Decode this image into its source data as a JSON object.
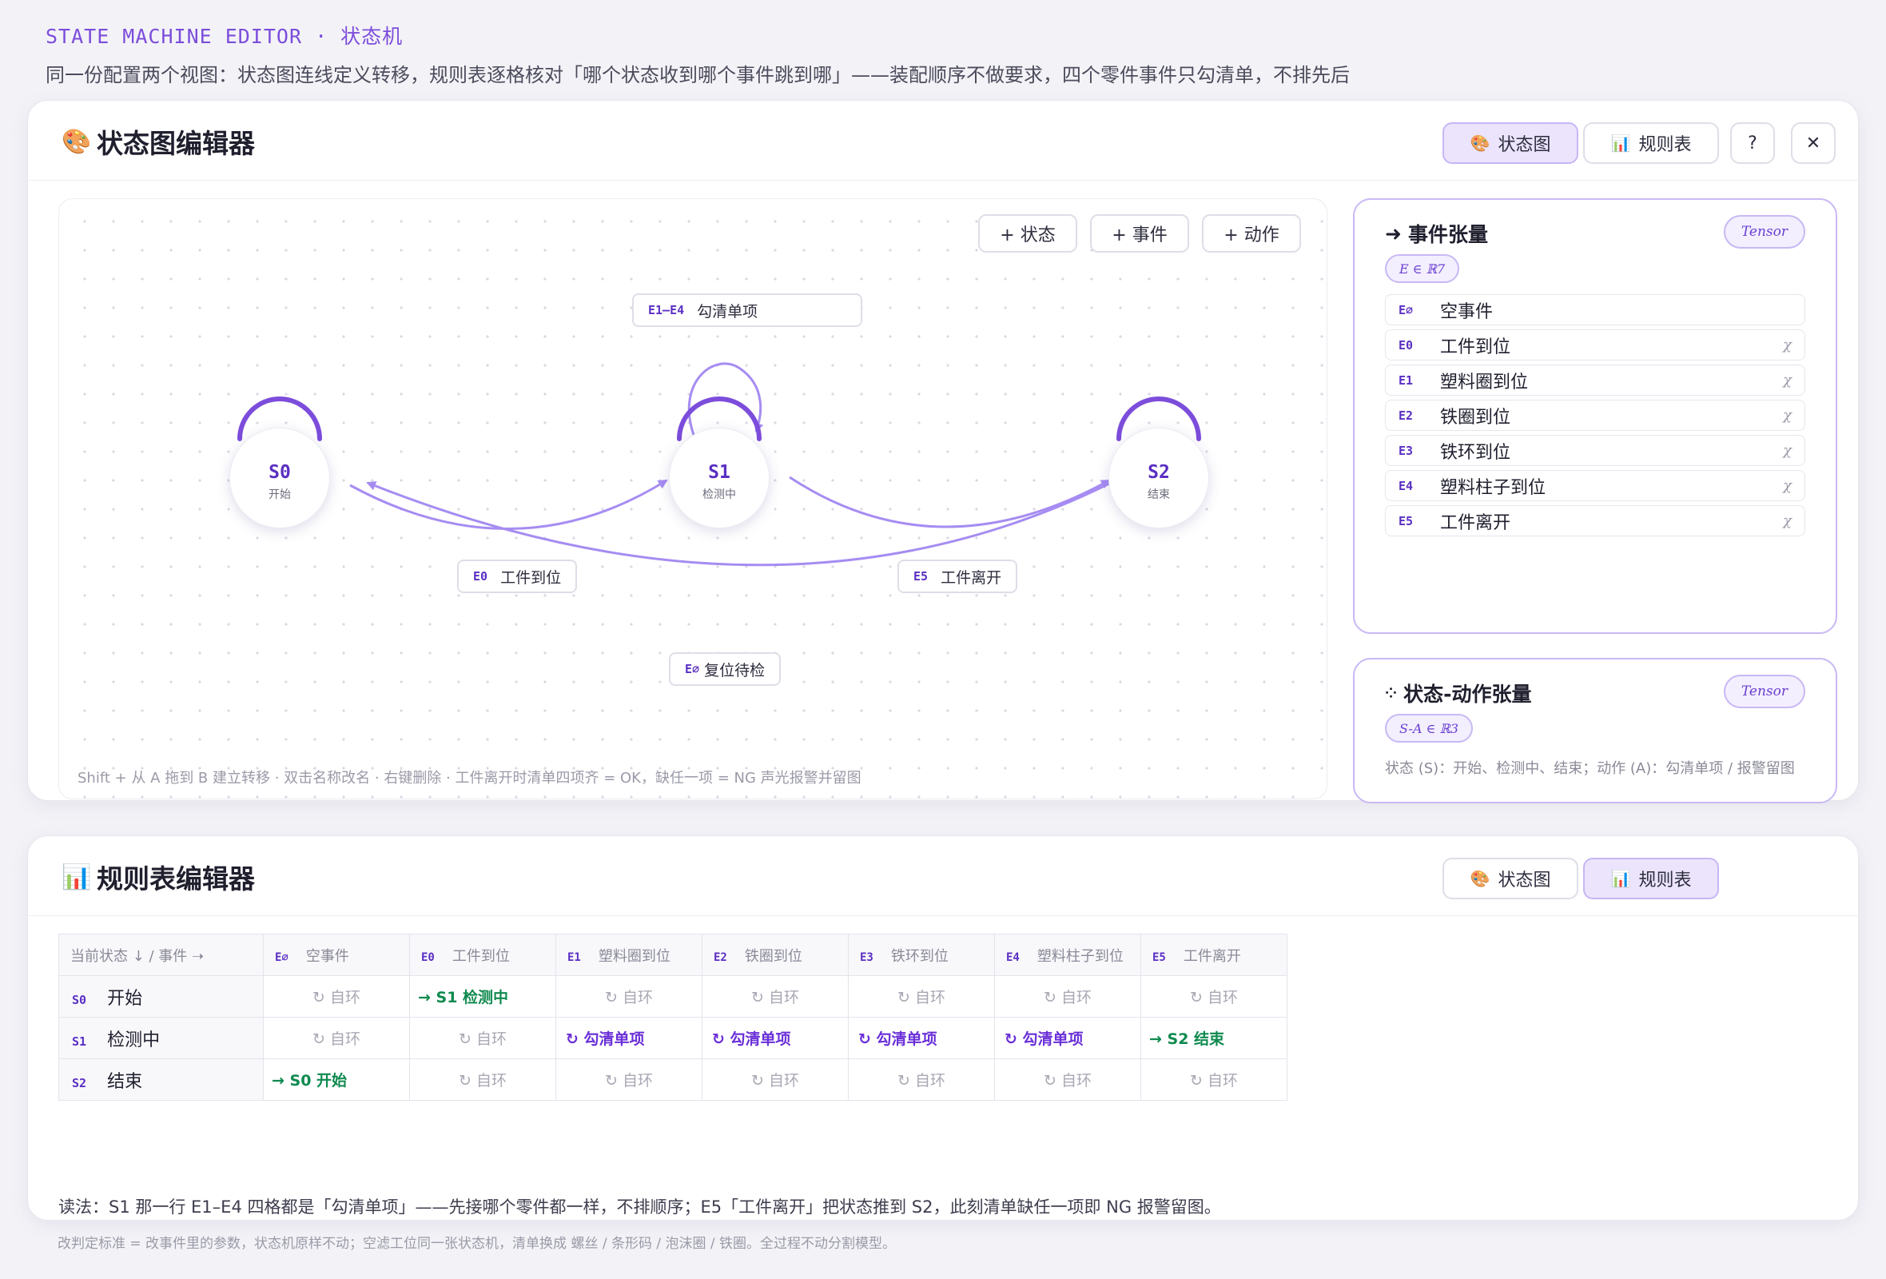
{
  "header": {
    "kicker": "STATE MACHINE EDITOR · 状态机",
    "subtitle": "同一份配置两个视图：状态图连线定义转移，规则表逐格核对「哪个状态收到哪个事件跳到哪」——装配顺序不做要求，四个零件事件只勾清单，不排先后"
  },
  "colors": {
    "accent": "#7c4ddb",
    "edge": "#a68cf2",
    "go": "#0f8a4f",
    "check": "#6a2fd8"
  },
  "diagram_panel": {
    "icon": "palette-icon",
    "title": "状态图编辑器",
    "tabs": {
      "diagram_icon": "🎨",
      "diagram": "状态图",
      "table_icon": "📊",
      "table": "规则表"
    },
    "help": "?",
    "close": "✕",
    "toolbar": {
      "add_state": "+ 状态",
      "add_event": "+ 事件",
      "add_action": "+ 动作"
    },
    "nodes": [
      {
        "id": "S0",
        "name": "开始"
      },
      {
        "id": "S1",
        "name": "检测中"
      },
      {
        "id": "S2",
        "name": "结束"
      }
    ],
    "edges": [
      {
        "event": "E1–E4",
        "label": "勾清单项"
      },
      {
        "event": "E0",
        "label": "工件到位"
      },
      {
        "event": "E5",
        "label": "工件离开"
      },
      {
        "event": "E∅",
        "label": "复位待检"
      }
    ],
    "hint": "Shift + 从 A 拖到 B 建立转移 · 双击名称改名 · 右键删除 · 工件离开时清单四项齐 = OK，缺任一项 = NG 声光报警并留图"
  },
  "event_tensor": {
    "arrow": "➜",
    "title": "事件张量",
    "badge": "Tensor",
    "signature": "E ∈ ℝ7",
    "delete_glyph": "χ",
    "events": [
      {
        "id": "E∅",
        "name": "空事件",
        "deletable": false
      },
      {
        "id": "E0",
        "name": "工件到位",
        "deletable": true
      },
      {
        "id": "E1",
        "name": "塑料圈到位",
        "deletable": true
      },
      {
        "id": "E2",
        "name": "铁圈到位",
        "deletable": true
      },
      {
        "id": "E3",
        "name": "铁环到位",
        "deletable": true
      },
      {
        "id": "E4",
        "name": "塑料柱子到位",
        "deletable": true
      },
      {
        "id": "E5",
        "name": "工件离开",
        "deletable": true
      }
    ]
  },
  "sa_tensor": {
    "icon": "sparkle-icon",
    "glyph": "⁘",
    "title": "状态-动作张量",
    "badge": "Tensor",
    "signature": "S-A ∈ ℝ3",
    "description": "状态 (S)：开始、检测中、结束；动作 (A)：勾清单项 / 报警留图"
  },
  "rule_panel": {
    "icon": "bar-chart-icon",
    "title": "规则表编辑器",
    "tabs": {
      "diagram_icon": "🎨",
      "diagram": "状态图",
      "table_icon": "📊",
      "table": "规则表"
    },
    "corner": "当前状态 ↓ / 事件 ➝",
    "columns": [
      {
        "id": "E∅",
        "name": "空事件"
      },
      {
        "id": "E0",
        "name": "工件到位"
      },
      {
        "id": "E1",
        "name": "塑料圈到位"
      },
      {
        "id": "E2",
        "name": "铁圈到位"
      },
      {
        "id": "E3",
        "name": "铁环到位"
      },
      {
        "id": "E4",
        "name": "塑料柱子到位"
      },
      {
        "id": "E5",
        "name": "工件离开"
      }
    ],
    "rows": [
      {
        "id": "S0",
        "name": "开始",
        "cells": [
          {
            "kind": "self",
            "text": "↻ 自环"
          },
          {
            "kind": "go",
            "text": "→ S1 检测中"
          },
          {
            "kind": "self",
            "text": "↻ 自环"
          },
          {
            "kind": "self",
            "text": "↻ 自环"
          },
          {
            "kind": "self",
            "text": "↻ 自环"
          },
          {
            "kind": "self",
            "text": "↻ 自环"
          },
          {
            "kind": "self",
            "text": "↻ 自环"
          }
        ]
      },
      {
        "id": "S1",
        "name": "检测中",
        "cells": [
          {
            "kind": "self",
            "text": "↻ 自环"
          },
          {
            "kind": "self",
            "text": "↻ 自环"
          },
          {
            "kind": "check",
            "text": "↻ 勾清单项"
          },
          {
            "kind": "check",
            "text": "↻ 勾清单项"
          },
          {
            "kind": "check",
            "text": "↻ 勾清单项"
          },
          {
            "kind": "check",
            "text": "↻ 勾清单项"
          },
          {
            "kind": "go",
            "text": "→ S2 结束"
          }
        ]
      },
      {
        "id": "S2",
        "name": "结束",
        "cells": [
          {
            "kind": "go",
            "text": "→ S0 开始"
          },
          {
            "kind": "self",
            "text": "↻ 自环"
          },
          {
            "kind": "self",
            "text": "↻ 自环"
          },
          {
            "kind": "self",
            "text": "↻ 自环"
          },
          {
            "kind": "self",
            "text": "↻ 自环"
          },
          {
            "kind": "self",
            "text": "↻ 自环"
          },
          {
            "kind": "self",
            "text": "↻ 自环"
          }
        ]
      }
    ],
    "reading_note": "读法：S1 那一行 E1–E4 四格都是「勾清单项」——先接哪个零件都一样，不排顺序；E5「工件离开」把状态推到 S2，此刻清单缺任一项即 NG 报警留图。"
  },
  "footer": "改判定标准 = 改事件里的参数，状态机原样不动；空滤工位同一张状态机，清单换成 螺丝 / 条形码 / 泡沫圈 / 铁圈。全过程不动分割模型。"
}
